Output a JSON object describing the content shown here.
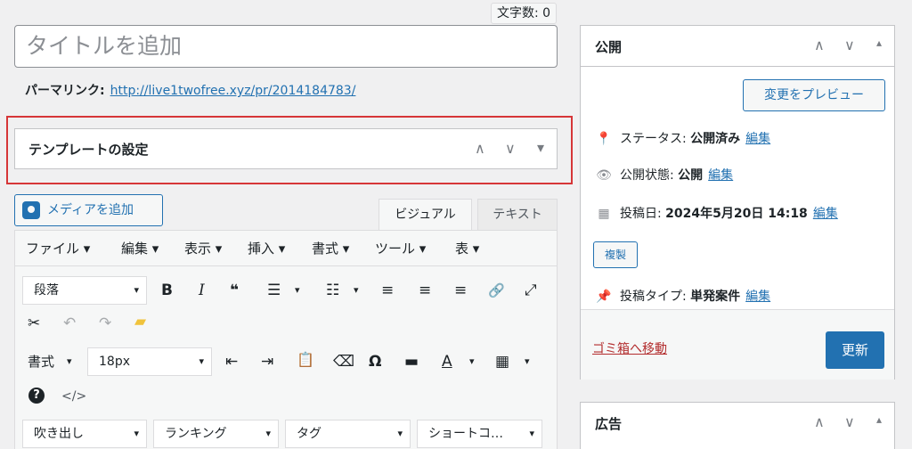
{
  "word_count": "文字数: 0",
  "title_placeholder": "タイトルを追加",
  "permalink": {
    "label": "パーマリンク:",
    "url": "http://live1twofree.xyz/pr/2014184783/"
  },
  "template_box": {
    "title": "テンプレートの設定"
  },
  "media_button": "メディアを追加",
  "editor_tabs": {
    "visual": "ビジュアル",
    "text": "テキスト"
  },
  "menubar": [
    "ファイル ▾",
    "編集 ▾",
    "表示 ▾",
    "挿入 ▾",
    "書式 ▾",
    "ツール ▾",
    "表 ▾"
  ],
  "toolbar": {
    "paragraph_select": "段落",
    "format_label": "書式",
    "fontsize_select": "18px",
    "balloon_select": "吹き出し",
    "ranking_select": "ランキング",
    "tag_select": "タグ",
    "shortcode_select": "ショートコ…"
  },
  "publish": {
    "title": "公開",
    "preview_button": "変更をプレビュー",
    "status_label": "ステータス:",
    "status_value": "公開済み",
    "visibility_label": "公開状態:",
    "visibility_value": "公開",
    "date_label": "投稿日:",
    "date_value": "2024年5月20日 14:18",
    "edit_link": "編集",
    "duplicate_button": "複製",
    "post_type_label": "投稿タイプ:",
    "post_type_value": "単発案件",
    "trash_link": "ゴミ箱へ移動",
    "update_button": "更新"
  },
  "ad_box": {
    "title": "広告"
  },
  "icons": {
    "up": "∧",
    "down": "∨",
    "toggle": "▾",
    "toggle_up": "▴",
    "bold": "B",
    "italic": "I",
    "quote": "❝",
    "ul": "☰",
    "ol": "☷",
    "align_left": "≡",
    "align_center": "≡",
    "align_right": "≡",
    "link": "🔗",
    "fullscreen": "⤢",
    "unlink": "✂",
    "undo": "↶",
    "redo": "↷",
    "note": "▰",
    "indent": "⇥",
    "outdent": "⇤",
    "paste": "📋",
    "eraser": "⌫",
    "omega": "Ω",
    "hr": "▬",
    "textcolor": "A",
    "table": "▦",
    "help": "?",
    "code": "</>",
    "pin": "📍",
    "eye": "👁",
    "calendar": "▦",
    "thumbtack": "📌"
  }
}
